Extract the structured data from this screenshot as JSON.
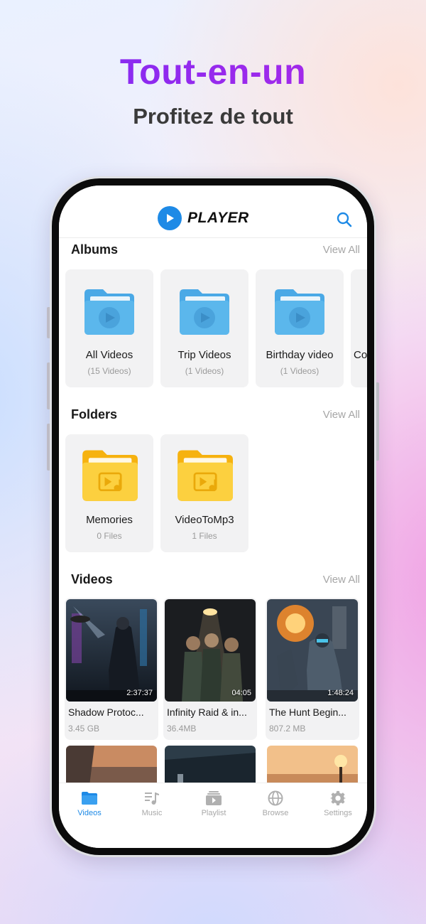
{
  "hero": {
    "title": "Tout-en-un",
    "subtitle": "Profitez de tout"
  },
  "app": {
    "name": "PLAYER",
    "search_icon": "search-icon"
  },
  "albums": {
    "title": "Albums",
    "view_all": "View All",
    "items": [
      {
        "name": "All Videos",
        "count": "(15 Videos)"
      },
      {
        "name": "Trip Videos",
        "count": "(1 Videos)"
      },
      {
        "name": "Birthday video",
        "count": "(1 Videos)"
      },
      {
        "name": "Cor",
        "count": ""
      }
    ]
  },
  "folders": {
    "title": "Folders",
    "view_all": "View All",
    "items": [
      {
        "name": "Memories",
        "count": "0 Files"
      },
      {
        "name": "VideoToMp3",
        "count": "1 Files"
      }
    ]
  },
  "videos": {
    "title": "Videos",
    "view_all": "View All",
    "items": [
      {
        "title": "Shadow Protoc...",
        "size": "3.45 GB",
        "duration": "2:37:37"
      },
      {
        "title": "Infinity Raid & in...",
        "size": "36.4MB",
        "duration": "04:05"
      },
      {
        "title": "The Hunt Begin...",
        "size": "807.2 MB",
        "duration": "1:48:24"
      }
    ]
  },
  "tabs": [
    {
      "label": "Videos",
      "icon": "folder-icon",
      "active": true
    },
    {
      "label": "Music",
      "icon": "music-icon",
      "active": false
    },
    {
      "label": "Playlist",
      "icon": "playlist-icon",
      "active": false
    },
    {
      "label": "Browse",
      "icon": "globe-icon",
      "active": false
    },
    {
      "label": "Settings",
      "icon": "gear-icon",
      "active": false
    }
  ],
  "colors": {
    "accent": "#1e8ae6",
    "album_folder": "#5bb7ec",
    "local_folder": "#fbc92e",
    "title_gradient_start": "#7b2cf4",
    "title_gradient_end": "#b128e6"
  }
}
